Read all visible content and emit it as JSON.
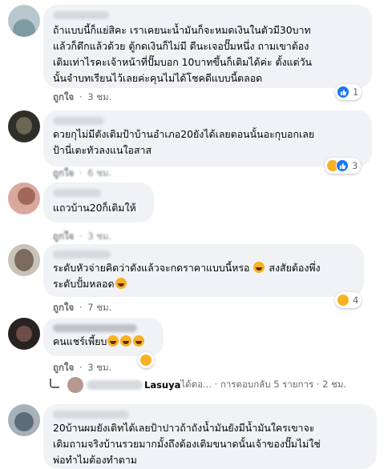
{
  "comments": [
    {
      "text": "ถ้าแบบนี้ก็แย่สิคะ เราเคยนะน้ำมันก็จะหมดเงินในตัวมี30บาท\nแล้วก็ดึกแล้วด้วย ตู้กดเงินก็ไม่มี ดีนะเจอปั๊มหนึ่ง ถามเขาต้อง\nเติมเท่าไรคะเจ้าหน้าที่ปั๊มบอก 10บาทขึ้นก็เติมได้ค่ะ ตั้งแต่วัน\nนั้นจำบทเรียนไว้เลยค่ะคุนไม่ได้โชคดีแบบนี้ตลอด",
      "like_label": "ถูกใจ",
      "time": "3 ชม.",
      "reaction_count": "1"
    },
    {
      "text": "ดวยกุไม่มีตังเติมป้าบ้านอำเภอ20ยังได้เลยตอนนั้นอะกุบอกเลย\nป้านี่เตะทัวลงแนใอสาส",
      "like_label": "ถูกใจ",
      "time": "6 ชม.",
      "reaction_count": "3"
    },
    {
      "text": "แถวบ้าน20ก็เติมให้",
      "like_label": "ถูกใจ",
      "time": "3 ชม."
    },
    {
      "text_line1": "ระดับหัวจ่ายคิดว่าดังแล้วจะกดราคาแบบนี้หรอ",
      "text_line1_tail": "สงสัยต้องพึ่ง",
      "text_line2": "ระดับปั้มหลอด",
      "like_label": "ถูกใจ",
      "time": "7 ชม.",
      "reaction_count": "4"
    },
    {
      "text": "คนแชร์เพี้ยบ",
      "like_label": "ถูกใจ",
      "time": "3 ชม."
    },
    {
      "text": "20บ้านผมยังเติทได้เลยป้าปาวถ้าถังน้ำมันยังมีน้ำมันใครเขาจะ\nเติมถามจริงบ้านรวยมากมั้งถึงต้องเติมขนาดนั้นเจ้าของปั๊มไม่ใช่\nพ่อทำไมต้องทำตาม"
    }
  ],
  "reply_preview": {
    "name": "Lasuya",
    "rest": " ได้ตอ... · การตอบกลับ 5 รายการ · 2 ชม."
  },
  "meta_separator": "·",
  "colors": {
    "bubble": "#f0f2f5",
    "meta_text": "#65676b",
    "like_blue": "#1877f2",
    "haha_yellow": "#f7b125"
  }
}
